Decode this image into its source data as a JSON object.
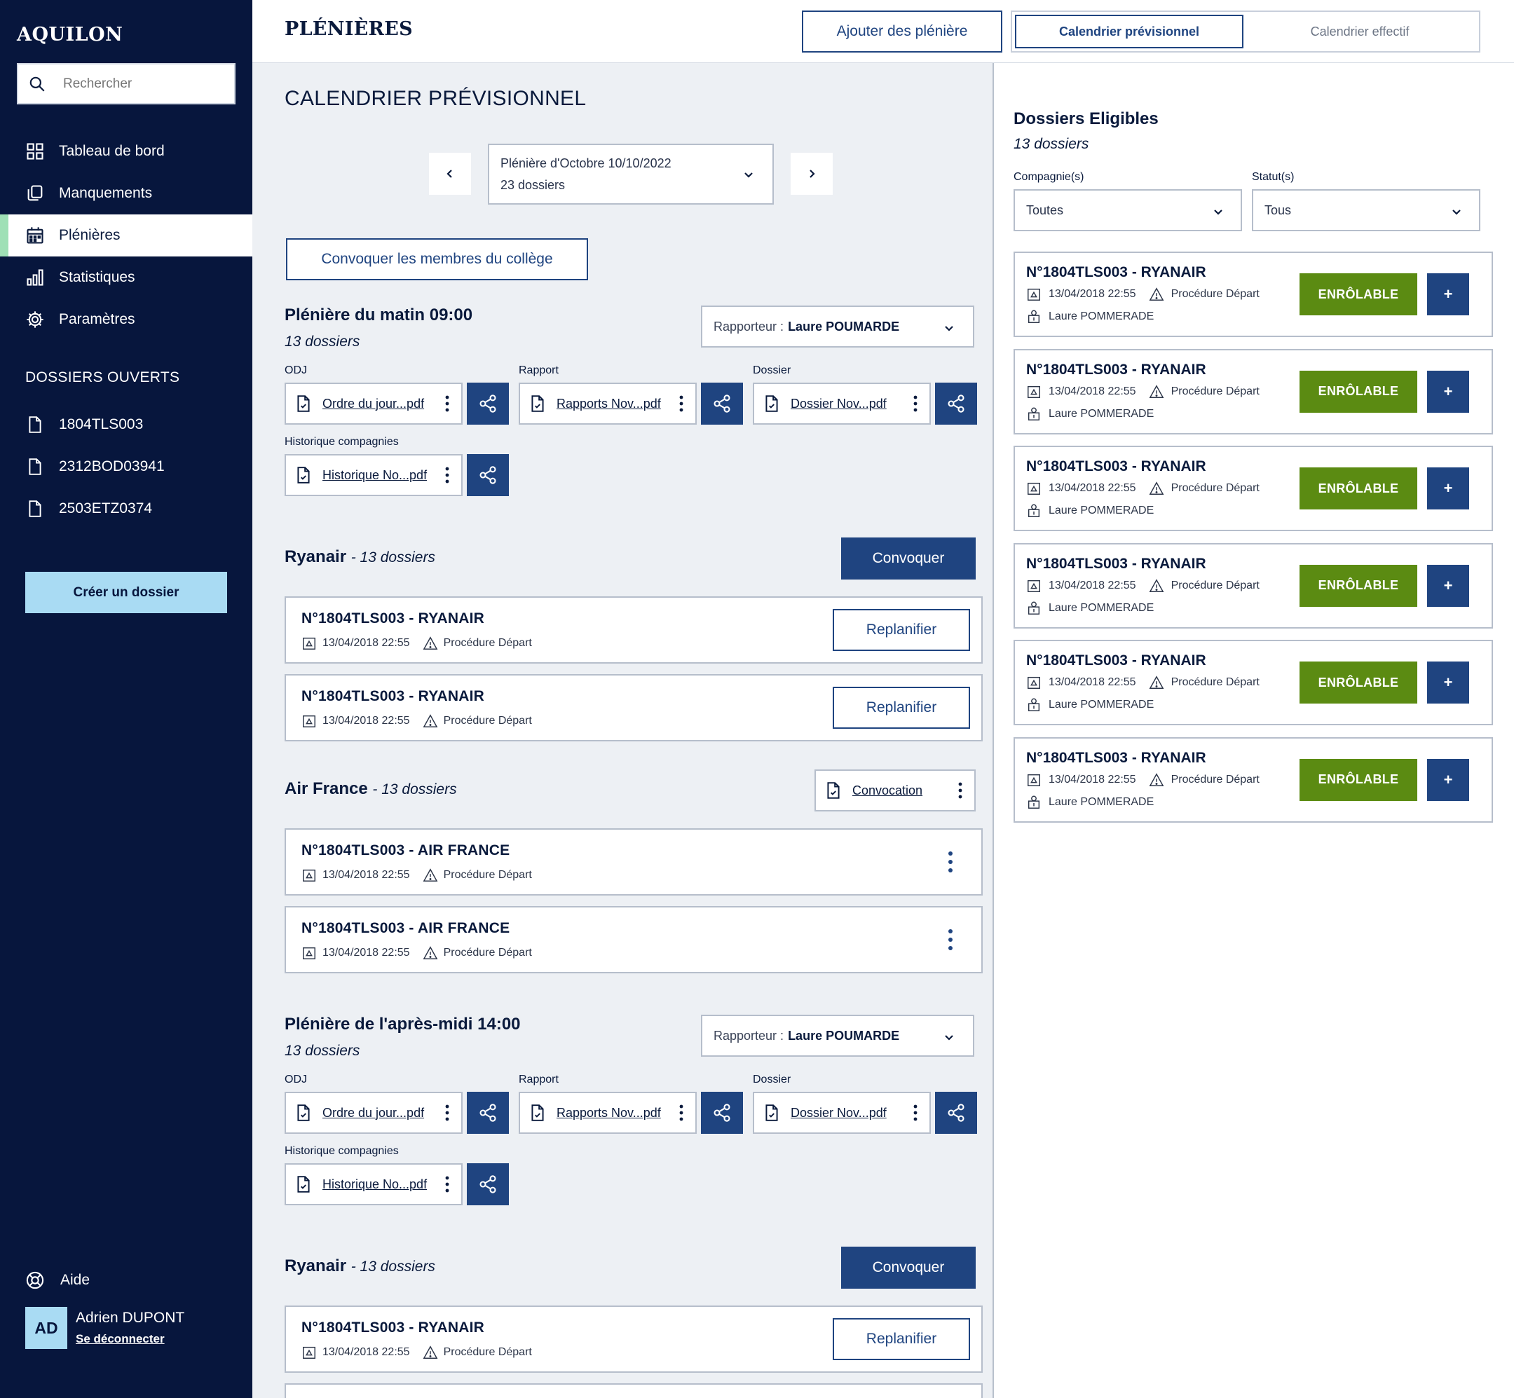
{
  "app": {
    "logo": "AQUILON"
  },
  "search": {
    "placeholder": "Rechercher"
  },
  "nav": {
    "items": [
      {
        "label": "Tableau de bord",
        "icon": "dashboard-icon"
      },
      {
        "label": "Manquements",
        "icon": "copy-icon"
      },
      {
        "label": "Plénières",
        "icon": "calendar-icon",
        "active": true
      },
      {
        "label": "Statistiques",
        "icon": "bar-chart-icon"
      },
      {
        "label": "Paramètres",
        "icon": "gear-icon"
      }
    ]
  },
  "open_files": {
    "title": "DOSSIERS OUVERTS",
    "items": [
      "1804TLS003",
      "2312BOD03941",
      "2503ETZ0374"
    ]
  },
  "sidebar": {
    "create_label": "Créer un dossier",
    "help_label": "Aide"
  },
  "user": {
    "initials": "AD",
    "name": "Adrien DUPONT",
    "logout": "Se déconnecter"
  },
  "header": {
    "title": "PLÉNIÈRES",
    "add_label": "Ajouter des plénière",
    "tab_active": "Calendrier prévisionnel",
    "tab_inactive": "Calendrier effectif"
  },
  "main": {
    "title": "CALENDRIER PRÉVISIONNEL",
    "selector": {
      "line1": "Plénière d'Octobre 10/10/2022",
      "line2": "23 dossiers"
    },
    "convoke_members": "Convoquer les membres du collège",
    "labels": {
      "odj": "ODJ",
      "rapport": "Rapport",
      "dossier": "Dossier",
      "historique": "Historique compagnies",
      "rapporteur_prefix": "Rapporteur :"
    },
    "sessions": [
      {
        "title": "Plénière du matin  09:00",
        "count": "13 dossiers",
        "rapporteur": "Laure POUMARDE",
        "files": {
          "odj": "Ordre du jour...pdf",
          "rapport": "Rapports Nov...pdf",
          "dossier": "Dossier Nov...pdf",
          "historique": "Historique No...pdf"
        }
      },
      {
        "title": "Plénière de l'après-midi  14:00",
        "count": "13 dossiers",
        "rapporteur": "Laure POUMARDE",
        "files": {
          "odj": "Ordre du jour...pdf",
          "rapport": "Rapports Nov...pdf",
          "dossier": "Dossier Nov...pdf",
          "historique": "Historique No...pdf"
        }
      }
    ],
    "groups": [
      {
        "name": "Ryanair",
        "count": "- 13 dossiers",
        "action": "Convoquer"
      },
      {
        "name": "Air France",
        "count": "- 13 dossiers",
        "file": "Convocation"
      },
      {
        "name": "Ryanair",
        "count": "- 13 dossiers",
        "action": "Convoquer"
      }
    ],
    "cases": [
      {
        "title": "N°1804TLS003  - RYANAIR",
        "date": "13/04/2018 22:55",
        "procedure": "Procédure Départ",
        "action": "Replanifier"
      },
      {
        "title": "N°1804TLS003  - RYANAIR",
        "date": "13/04/2018 22:55",
        "procedure": "Procédure Départ",
        "action": "Replanifier"
      },
      {
        "title": "N°1804TLS003  - AIR FRANCE",
        "date": "13/04/2018 22:55",
        "procedure": "Procédure Départ"
      },
      {
        "title": "N°1804TLS003  - AIR FRANCE",
        "date": "13/04/2018 22:55",
        "procedure": "Procédure Départ"
      },
      {
        "title": "N°1804TLS003  - RYANAIR",
        "date": "13/04/2018 22:55",
        "procedure": "Procédure Départ",
        "action": "Replanifier"
      }
    ]
  },
  "eligible": {
    "title": "Dossiers Eligibles",
    "count": "13 dossiers",
    "filters": [
      {
        "label": "Compagnie(s)",
        "value": "Toutes"
      },
      {
        "label": "Statut(s)",
        "value": "Tous"
      }
    ],
    "cards": [
      {
        "title": "N°1804TLS003  - RYANAIR",
        "date": "13/04/2018 22:55",
        "procedure": "Procédure Départ",
        "user": "Laure POMMERADE",
        "status": "ENRÔLABLE",
        "plus": "+"
      },
      {
        "title": "N°1804TLS003  - RYANAIR",
        "date": "13/04/2018 22:55",
        "procedure": "Procédure Départ",
        "user": "Laure POMMERADE",
        "status": "ENRÔLABLE",
        "plus": "+"
      },
      {
        "title": "N°1804TLS003  - RYANAIR",
        "date": "13/04/2018 22:55",
        "procedure": "Procédure Départ",
        "user": "Laure POMMERADE",
        "status": "ENRÔLABLE",
        "plus": "+"
      },
      {
        "title": "N°1804TLS003  - RYANAIR",
        "date": "13/04/2018 22:55",
        "procedure": "Procédure Départ",
        "user": "Laure POMMERADE",
        "status": "ENRÔLABLE",
        "plus": "+"
      },
      {
        "title": "N°1804TLS003  - RYANAIR",
        "date": "13/04/2018 22:55",
        "procedure": "Procédure Départ",
        "user": "Laure POMMERADE",
        "status": "ENRÔLABLE",
        "plus": "+"
      },
      {
        "title": "N°1804TLS003  - RYANAIR",
        "date": "13/04/2018 22:55",
        "procedure": "Procédure Départ",
        "user": "Laure POMMERADE",
        "status": "ENRÔLABLE",
        "plus": "+"
      }
    ]
  },
  "colors": {
    "sidebar": "#07163d",
    "primary": "#1f4480",
    "success": "#5b8b12",
    "accent": "#a9dbf3",
    "active_marker": "#9fe0b6"
  }
}
